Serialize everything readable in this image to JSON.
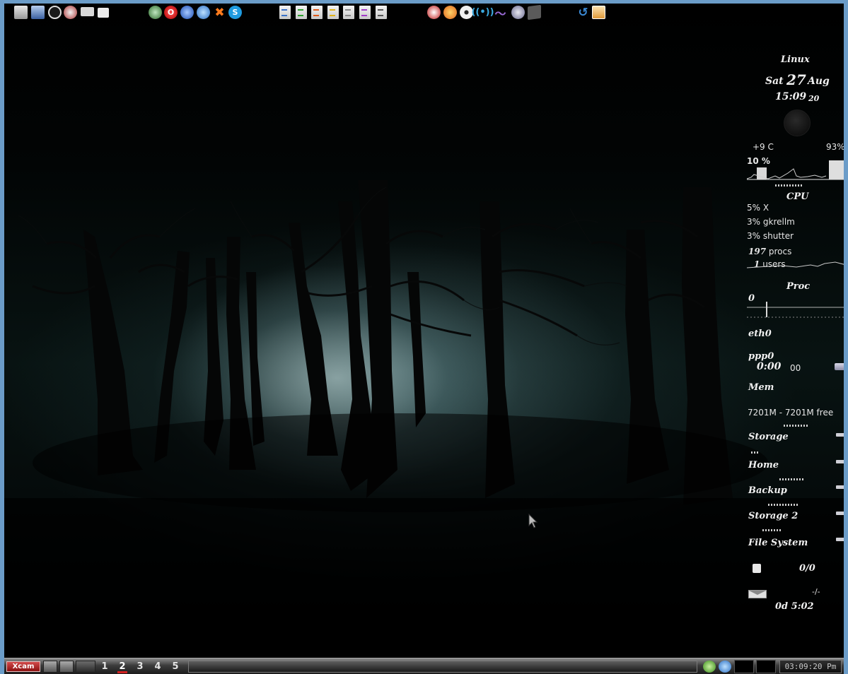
{
  "launcher": {
    "icons": [
      "file-manager-icon",
      "network-icon",
      "clock-app-icon",
      "settings-icon",
      "monitor-icon",
      "windows-icon",
      "internet-icon",
      "opera-icon",
      "browser-icon",
      "web-icon",
      "tools-icon",
      "skype-icon",
      "text-doc-icon",
      "spreadsheet-icon",
      "presentation-icon",
      "drawing-icon",
      "writer-icon",
      "math-icon",
      "pdf-icon",
      "media-icon",
      "firefox-icon",
      "disc-icon",
      "wifi-icon",
      "audio-wave-icon",
      "pidgin-icon",
      "terminal-icon",
      "update-icon",
      "package-icon"
    ]
  },
  "gkrellm": {
    "hostname": "Linux",
    "day": "Sat",
    "date_num": "27",
    "month": "Aug",
    "time": "15:09",
    "seconds": "20",
    "temp": "+9 C",
    "battery": "93%",
    "cpu_load": "10 %",
    "cpu_label": "CPU",
    "top_procs": [
      {
        "pct": "5%",
        "name": "X"
      },
      {
        "pct": "3%",
        "name": "gkrellm"
      },
      {
        "pct": "3%",
        "name": "shutter"
      }
    ],
    "procs_count": "197",
    "procs_label": "procs",
    "users_count": "1",
    "users_label": "users",
    "proc_label": "Proc",
    "proc_value": "0",
    "eth_label": "eth0",
    "ppp_label": "ppp0",
    "ppp_time": "0:00",
    "ppp_extra": "00",
    "mem_label": "Mem",
    "mem_text": "7201M - 7201M free",
    "disks": [
      "Storage",
      "Home",
      "Backup",
      "Storage 2",
      "File System"
    ],
    "mail_count": "0/0",
    "mail_icon": "mail-icon",
    "uptime_marker": "-/-",
    "uptime": "0d  5:02"
  },
  "taskbar": {
    "start_label": "Xcam",
    "workspaces": [
      "1",
      "2",
      "3",
      "4",
      "5"
    ],
    "active_workspace": "2",
    "clock": "03:09:20 Pm"
  },
  "colors": {
    "screen_border": "#6b9cc8",
    "active_workspace_marker": "#d22020"
  }
}
